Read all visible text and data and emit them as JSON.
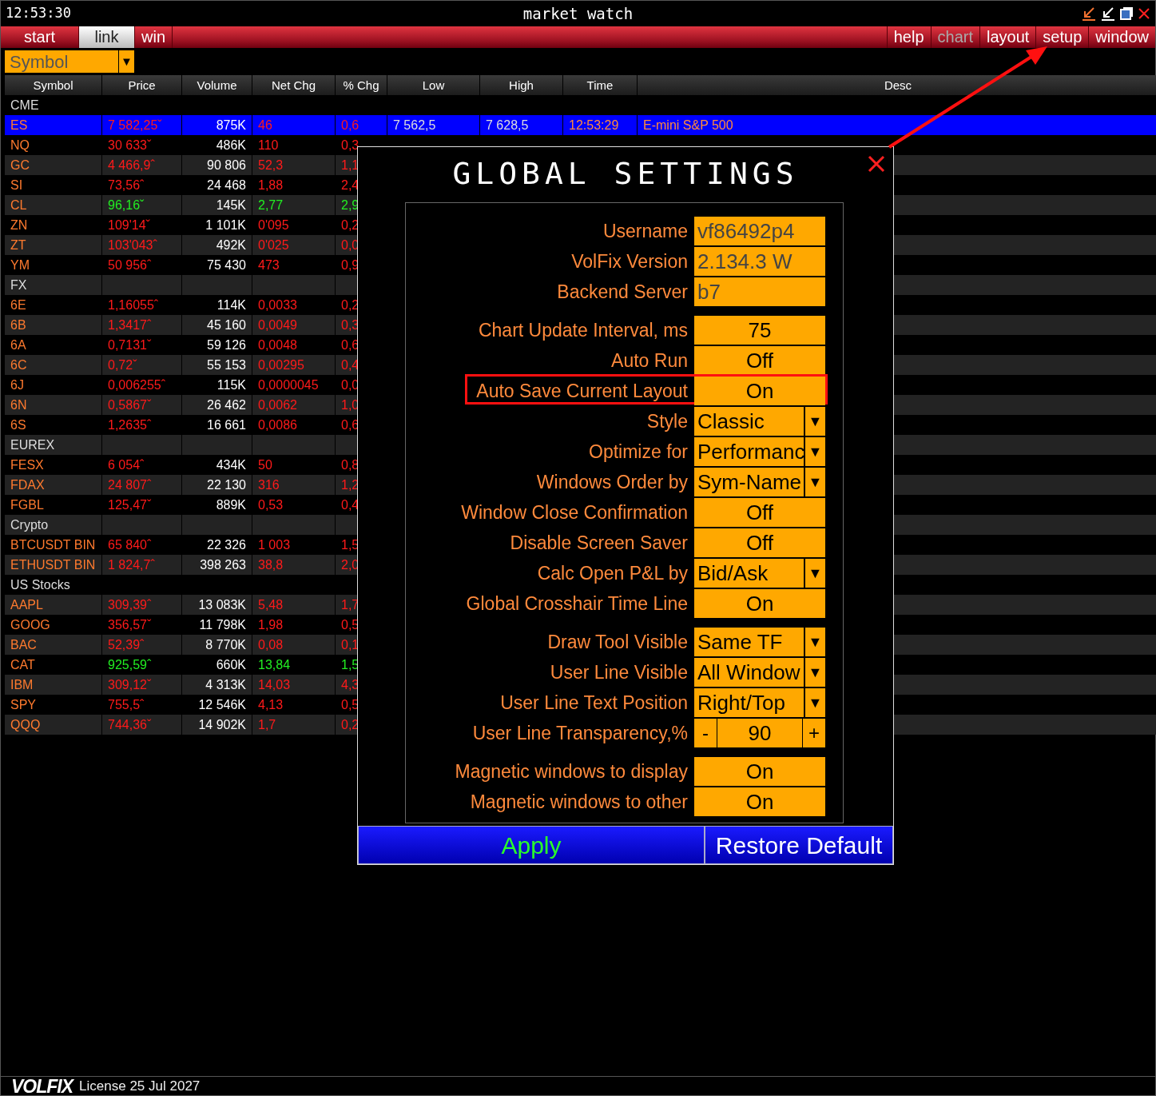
{
  "title_bar": {
    "time": "12:53:30",
    "title": "market watch"
  },
  "menu_left": [
    {
      "label": "start",
      "selected": false
    },
    {
      "label": "link",
      "selected": true
    },
    {
      "label": "win",
      "selected": false
    }
  ],
  "menu_right": [
    {
      "label": "help",
      "disabled": false
    },
    {
      "label": "chart",
      "disabled": true
    },
    {
      "label": "layout",
      "disabled": false
    },
    {
      "label": "setup",
      "disabled": false
    },
    {
      "label": "window",
      "disabled": false
    }
  ],
  "symbol_filter": {
    "value": "Symbol",
    "caret": "▼"
  },
  "table": {
    "columns": [
      "Symbol",
      "Price",
      "Volume",
      "Net Chg",
      "% Chg",
      "Low",
      "High",
      "Time",
      "Desc"
    ],
    "rows": [
      {
        "kind": "group",
        "selected": false,
        "cells": [
          "CME"
        ]
      },
      {
        "kind": "quote",
        "selected": true,
        "gain": false,
        "cells": [
          "ES",
          "7 582,25ˇ",
          "875K",
          "46",
          "0,6",
          "7 562,5",
          "7 628,5",
          "12:53:29",
          "E-mini S&P 500"
        ]
      },
      {
        "kind": "quote",
        "selected": false,
        "gain": false,
        "cells": [
          "NQ",
          "30 633ˇ",
          "486K",
          "110",
          "0,3"
        ]
      },
      {
        "kind": "quote",
        "selected": false,
        "gain": false,
        "cells": [
          "GC",
          "4 466,9ˆ",
          "90 806",
          "52,3",
          "1,1"
        ]
      },
      {
        "kind": "quote",
        "selected": false,
        "gain": false,
        "cells": [
          "SI",
          "73,56ˆ",
          "24 468",
          "1,88",
          "2,4"
        ]
      },
      {
        "kind": "quote",
        "selected": false,
        "gain": true,
        "cells": [
          "CL",
          "96,16ˇ",
          "145K",
          "2,77",
          "2,9"
        ]
      },
      {
        "kind": "quote",
        "selected": false,
        "gain": false,
        "cells": [
          "ZN",
          "109'14ˇ",
          "1 101K",
          "0'095",
          "0,2"
        ]
      },
      {
        "kind": "quote",
        "selected": false,
        "gain": false,
        "cells": [
          "ZT",
          "103'043ˆ",
          "492K",
          "0'025",
          "0,0"
        ]
      },
      {
        "kind": "quote",
        "selected": false,
        "gain": false,
        "cells": [
          "YM",
          "50 956ˆ",
          "75 430",
          "473",
          "0,9"
        ]
      },
      {
        "kind": "group",
        "selected": false,
        "cells": [
          "FX"
        ]
      },
      {
        "kind": "quote",
        "selected": false,
        "gain": false,
        "cells": [
          "6E",
          "1,16055ˆ",
          "114K",
          "0,0033",
          "0,2"
        ]
      },
      {
        "kind": "quote",
        "selected": false,
        "gain": false,
        "cells": [
          "6B",
          "1,3417ˆ",
          "45 160",
          "0,0049",
          "0,3"
        ]
      },
      {
        "kind": "quote",
        "selected": false,
        "gain": false,
        "cells": [
          "6A",
          "0,7131ˇ",
          "59 126",
          "0,0048",
          "0,6"
        ]
      },
      {
        "kind": "quote",
        "selected": false,
        "gain": false,
        "cells": [
          "6C",
          "0,72ˇ",
          "55 153",
          "0,00295",
          "0,4"
        ]
      },
      {
        "kind": "quote",
        "selected": false,
        "gain": false,
        "cells": [
          "6J",
          "0,006255ˆ",
          "115K",
          "0,0000045",
          "0,0"
        ]
      },
      {
        "kind": "quote",
        "selected": false,
        "gain": false,
        "cells": [
          "6N",
          "0,5867ˇ",
          "26 462",
          "0,0062",
          "1,0"
        ]
      },
      {
        "kind": "quote",
        "selected": false,
        "gain": false,
        "cells": [
          "6S",
          "1,2635ˆ",
          "16 661",
          "0,0086",
          "0,6"
        ]
      },
      {
        "kind": "group",
        "selected": false,
        "cells": [
          "EUREX"
        ]
      },
      {
        "kind": "quote",
        "selected": false,
        "gain": false,
        "cells": [
          "FESX",
          "6 054ˆ",
          "434K",
          "50",
          "0,8"
        ]
      },
      {
        "kind": "quote",
        "selected": false,
        "gain": false,
        "cells": [
          "FDAX",
          "24 807ˆ",
          "22 130",
          "316",
          "1,2"
        ]
      },
      {
        "kind": "quote",
        "selected": false,
        "gain": false,
        "cells": [
          "FGBL",
          "125,47ˇ",
          "889K",
          "0,53",
          "0,4"
        ]
      },
      {
        "kind": "group",
        "selected": false,
        "cells": [
          "Crypto"
        ]
      },
      {
        "kind": "quote",
        "selected": false,
        "gain": false,
        "cells": [
          "BTCUSDT BIN",
          "65 840ˆ",
          "22 326",
          "1 003",
          "1,5"
        ]
      },
      {
        "kind": "quote",
        "selected": false,
        "gain": false,
        "cells": [
          "ETHUSDT BIN",
          "1 824,7ˆ",
          "398 263",
          "38,8",
          "2,0"
        ]
      },
      {
        "kind": "group",
        "selected": false,
        "cells": [
          "US Stocks"
        ]
      },
      {
        "kind": "quote",
        "selected": false,
        "gain": false,
        "cells": [
          "AAPL",
          "309,39ˆ",
          "13 083K",
          "5,48",
          "1,7"
        ]
      },
      {
        "kind": "quote",
        "selected": false,
        "gain": false,
        "cells": [
          "GOOG",
          "356,57ˇ",
          "11 798K",
          "1,98",
          "0,5"
        ]
      },
      {
        "kind": "quote",
        "selected": false,
        "gain": false,
        "cells": [
          "BAC",
          "52,39ˆ",
          "8 770K",
          "0,08",
          "0,1"
        ]
      },
      {
        "kind": "quote",
        "selected": false,
        "gain": true,
        "cells": [
          "CAT",
          "925,59ˆ",
          "660K",
          "13,84",
          "1,5"
        ]
      },
      {
        "kind": "quote",
        "selected": false,
        "gain": false,
        "cells": [
          "IBM",
          "309,12ˇ",
          "4 313K",
          "14,03",
          "4,3"
        ]
      },
      {
        "kind": "quote",
        "selected": false,
        "gain": false,
        "cells": [
          "SPY",
          "755,5ˆ",
          "12 546K",
          "4,13",
          "0,5"
        ]
      },
      {
        "kind": "quote",
        "selected": false,
        "gain": false,
        "cells": [
          "QQQ",
          "744,36ˇ",
          "14 902K",
          "1,7",
          "0,2"
        ]
      }
    ]
  },
  "dialog": {
    "title": "GLOBAL SETTINGS",
    "groups": [
      [
        {
          "kind": "info",
          "label": "Username",
          "value": "vf86492p4",
          "highlighted": false
        },
        {
          "kind": "info",
          "label": "VolFix Version",
          "value": "2.134.3 W",
          "highlighted": false
        },
        {
          "kind": "info",
          "label": "Backend Server",
          "value": "b7",
          "highlighted": false
        }
      ],
      [
        {
          "kind": "toggle",
          "label": "Chart Update Interval, ms",
          "value": "75",
          "highlighted": false
        },
        {
          "kind": "toggle",
          "label": "Auto Run",
          "value": "Off",
          "highlighted": false
        },
        {
          "kind": "toggle",
          "label": "Auto Save Current Layout",
          "value": "On",
          "highlighted": true
        },
        {
          "kind": "select",
          "label": "Style",
          "value": "Classic",
          "caret": "▼",
          "highlighted": false
        },
        {
          "kind": "select",
          "label": "Optimize for",
          "value": "Performanc",
          "caret": "▼",
          "highlighted": false
        },
        {
          "kind": "select",
          "label": "Windows Order by",
          "value": "Sym-Name",
          "caret": "▼",
          "highlighted": false
        },
        {
          "kind": "toggle",
          "label": "Window Close Confirmation",
          "value": "Off",
          "highlighted": false
        },
        {
          "kind": "toggle",
          "label": "Disable Screen Saver",
          "value": "Off",
          "highlighted": false
        },
        {
          "kind": "select",
          "label": "Calc Open P&L by",
          "value": "Bid/Ask",
          "caret": "▼",
          "highlighted": false
        },
        {
          "kind": "toggle",
          "label": "Global Crosshair Time Line",
          "value": "On",
          "highlighted": false
        }
      ],
      [
        {
          "kind": "select",
          "label": "Draw Tool Visible",
          "value": "Same TF",
          "caret": "▼",
          "highlighted": false
        },
        {
          "kind": "select",
          "label": "User Line Visible",
          "value": "All Window",
          "caret": "▼",
          "highlighted": false
        },
        {
          "kind": "select",
          "label": "User Line Text Position",
          "value": "Right/Top",
          "caret": "▼",
          "highlighted": false
        },
        {
          "kind": "stepper",
          "label": "User Line Transparency,%",
          "value": "90",
          "minus": "-",
          "plus": "+",
          "highlighted": false
        }
      ],
      [
        {
          "kind": "toggle",
          "label": "Magnetic windows to display",
          "value": "On",
          "highlighted": false
        },
        {
          "kind": "toggle",
          "label": "Magnetic windows to other",
          "value": "On",
          "highlighted": false
        }
      ]
    ],
    "buttons": [
      {
        "label": "Apply",
        "kind": "primary"
      },
      {
        "label": "Restore Default",
        "kind": "secondary"
      }
    ]
  },
  "footer": {
    "logo": "VOLFIX",
    "license": "License 25 Jul 2027"
  }
}
